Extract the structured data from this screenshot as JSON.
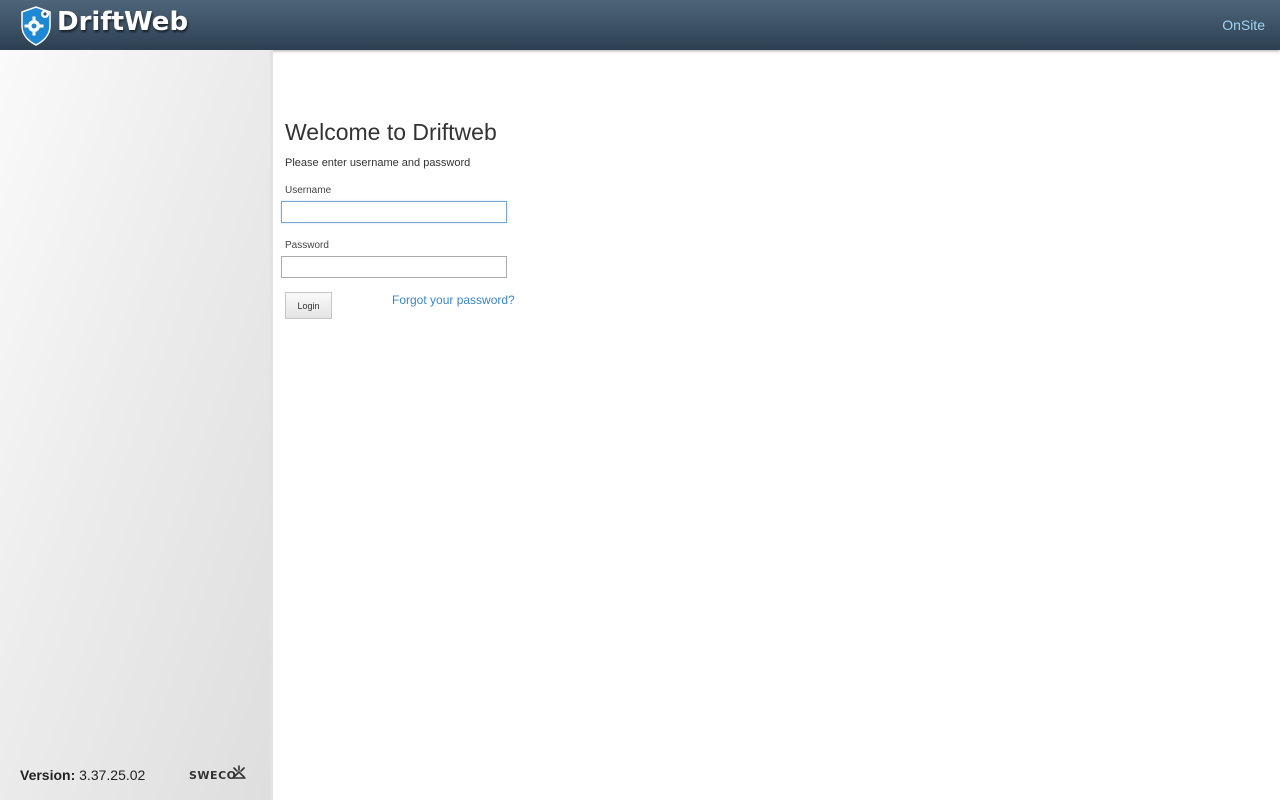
{
  "header": {
    "brand": "DriftWeb",
    "right_link": "OnSite",
    "logo_icon": "gear-shield-icon"
  },
  "sidebar": {
    "version_label": "Version:",
    "version_value": "3.37.25.02",
    "sweco_logo": "SWECO"
  },
  "login": {
    "title": "Welcome to Driftweb",
    "subtitle": "Please enter username and password",
    "username_label": "Username",
    "username_value": "",
    "password_label": "Password",
    "password_value": "",
    "login_button": "Login",
    "forgot_link": "Forgot your password?"
  },
  "colors": {
    "header_top": "#4e6579",
    "header_bottom": "#2d4052",
    "link": "#3a86c8",
    "onsite_link": "#9fd3f2"
  }
}
